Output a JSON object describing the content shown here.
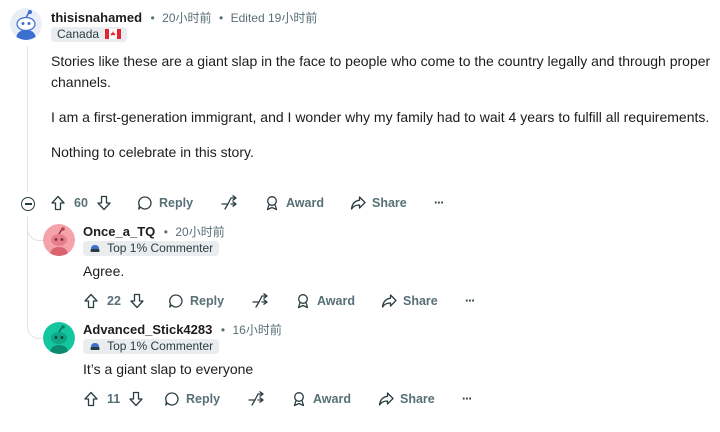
{
  "top_comment": {
    "username": "thisisnahamed",
    "time": "20小时前",
    "edited": "Edited 19小时前",
    "flair": "Canada",
    "flair_flag": "🇨🇦",
    "paragraphs": [
      "Stories like these are a giant slap in the face to people who come to the country legally and through proper channels.",
      "I am a first-generation immigrant, and I wonder why my family had to wait 4 years to fulfill all requirements.",
      "Nothing to celebrate in this story."
    ],
    "votes": "60",
    "avatar_color": "#3b6fd0"
  },
  "replies": [
    {
      "username": "Once_a_TQ",
      "time": "20小时前",
      "flair": "Top 1% Commenter",
      "text": "Agree.",
      "votes": "22",
      "avatar_color": "#f4a3aa"
    },
    {
      "username": "Advanced_Stick4283",
      "time": "16小时前",
      "flair": "Top 1% Commenter",
      "text": "It’s a giant slap to everyone",
      "votes": "11",
      "avatar_color": "#14c6a0"
    }
  ],
  "actions": {
    "reply": "Reply",
    "award": "Award",
    "share": "Share",
    "more": "···"
  },
  "separator": "•",
  "colors": {
    "meta": "#576f76",
    "flair_bg": "#eaedef",
    "thread_line": "#e0e3e5"
  }
}
